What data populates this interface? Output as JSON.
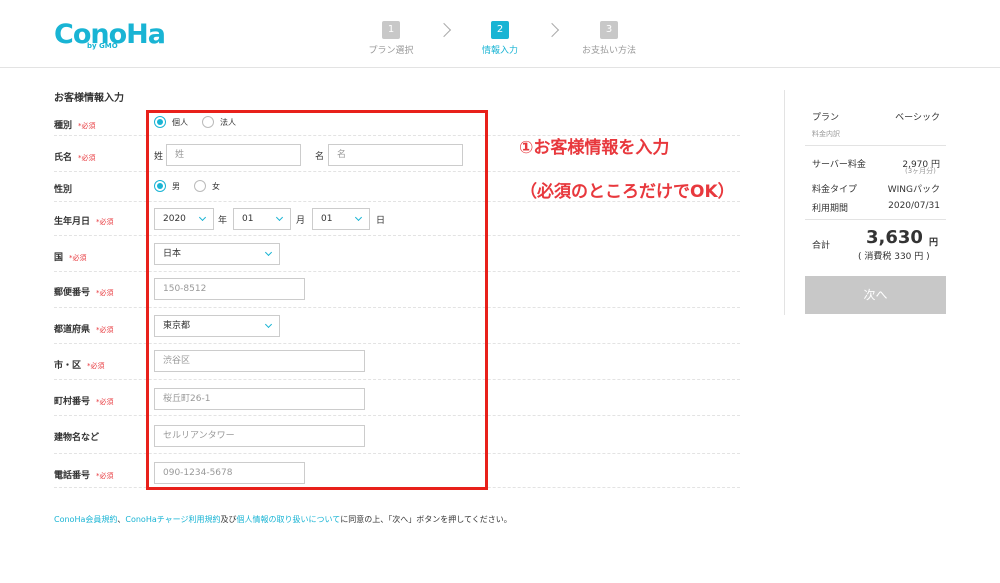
{
  "header": {
    "logo": "ConoHa",
    "logo_sub": "by GMO",
    "steps": [
      {
        "num": "1",
        "label": "プラン選択"
      },
      {
        "num": "2",
        "label": "情報入力"
      },
      {
        "num": "3",
        "label": "お支払い方法"
      }
    ]
  },
  "form": {
    "title": "お客様情報入力",
    "required": "*必須",
    "type": {
      "label": "種別",
      "opt1": "個人",
      "opt2": "法人"
    },
    "name": {
      "label": "氏名",
      "sei_label": "姓",
      "sei_placeholder": "姓",
      "mei_label": "名",
      "mei_placeholder": "名"
    },
    "gender": {
      "label": "性別",
      "opt1": "男",
      "opt2": "女"
    },
    "birthday": {
      "label": "生年月日",
      "year": "2020",
      "year_unit": "年",
      "month": "01",
      "month_unit": "月",
      "day": "01",
      "day_unit": "日"
    },
    "country": {
      "label": "国",
      "value": "日本"
    },
    "postal": {
      "label": "郵便番号",
      "placeholder": "150-8512"
    },
    "prefecture": {
      "label": "都道府県",
      "value": "東京都"
    },
    "city": {
      "label": "市・区",
      "placeholder": "渋谷区"
    },
    "town": {
      "label": "町村番号",
      "placeholder": "桜丘町26-1"
    },
    "building": {
      "label": "建物名など",
      "placeholder": "セルリアンタワー"
    },
    "phone": {
      "label": "電話番号",
      "placeholder": "090-1234-5678"
    }
  },
  "annotation": {
    "line1": "①お客様情報を入力",
    "line2": "（必須のところだけでOK）"
  },
  "summary": {
    "plan_label": "プラン",
    "plan_value": "ベーシック",
    "breakdown": "料金内訳",
    "server_label": "サーバー料金",
    "server_value": "2,970 円",
    "server_sub": "(3ヶ月分)",
    "type_label": "料金タイプ",
    "type_value": "WINGパック",
    "period_label": "利用期間",
    "period_value": "2020/07/31",
    "total_label": "合計",
    "total_value": "3,630",
    "total_unit": "円",
    "tax": "( 消費税 330 円 )",
    "next_button": "次へ"
  },
  "footer": {
    "link1": "ConoHa会員規約",
    "sep1": "、",
    "link2": "ConoHaチャージ利用規約",
    "sep2": "及び",
    "link3": "個人情報の取り扱いについて",
    "text": "に同意の上、「次へ」ボタンを押してください。"
  },
  "colors": {
    "accent": "#19b4d4",
    "required": "#e8383d",
    "annotation_box": "#e8201a",
    "disabled_button": "#c8c8c8"
  }
}
